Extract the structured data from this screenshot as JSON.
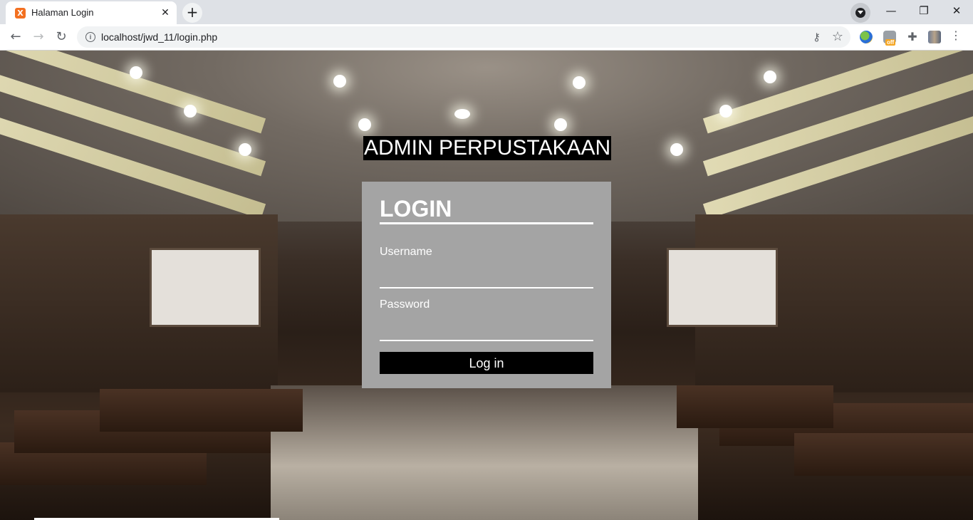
{
  "browser": {
    "tab_title": "Halaman Login",
    "favicon_glyph": "X",
    "close_tab": "✕",
    "new_tab": "+",
    "window": {
      "minimize": "—",
      "restore": "❐",
      "close": "✕"
    },
    "nav": {
      "back": "←",
      "forward": "→",
      "reload": "↻"
    },
    "url": "localhost/jwd_11/login.php",
    "info_glyph": "i",
    "key_glyph": "⚷",
    "star_glyph": "☆",
    "puzzle_glyph": "✚",
    "menu_glyph": "⋮",
    "ext_badge": "off"
  },
  "page": {
    "site_title": "ADMIN PERPUSTAKAAN",
    "login": {
      "heading": "LOGIN",
      "username_label": "Username",
      "username_value": "",
      "password_label": "Password",
      "password_value": "",
      "submit_label": "Log in"
    }
  },
  "colors": {
    "login_panel": "#a4a4a4",
    "button_bg": "#000000",
    "title_bg": "#000000",
    "accent_favicon": "#f37021"
  }
}
